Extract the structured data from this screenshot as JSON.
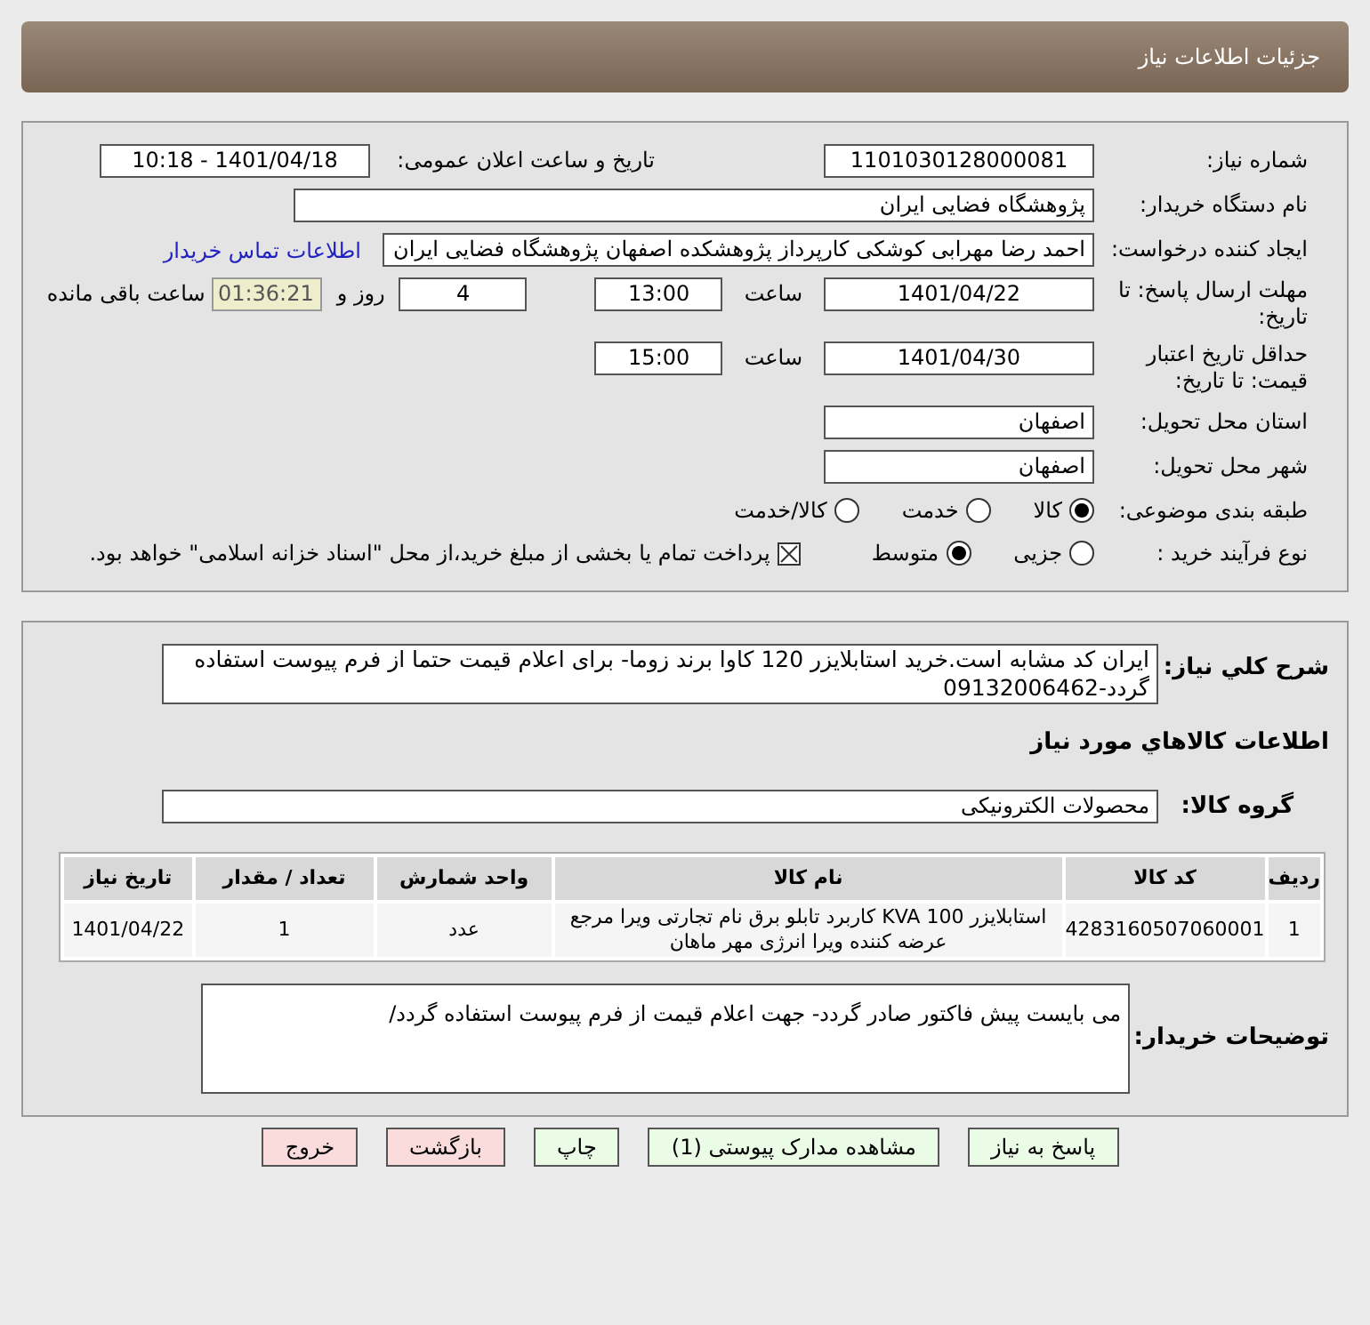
{
  "header": {
    "title": "جزئیات اطلاعات نیاز"
  },
  "need": {
    "need_number": {
      "label": "شماره نیاز:",
      "value": "1101030128000081"
    },
    "announce": {
      "label": "تاریخ و ساعت اعلان عمومی:",
      "value": "1401/04/18 - 10:18"
    },
    "buyer_org": {
      "label": "نام دستگاه خریدار:",
      "value": "پژوهشگاه فضایی ایران"
    },
    "requester": {
      "label": "ایجاد کننده درخواست:",
      "value": "احمد رضا مهرابی کوشکی کارپرداز پژوهشکده اصفهان پژوهشگاه فضایی ایران",
      "link": "اطلاعات تماس خریدار"
    },
    "response_deadline": {
      "label": "مهلت ارسال پاسخ: تا تاریخ:",
      "date": "1401/04/22",
      "time_label": "ساعت",
      "time": "13:00",
      "days": "4",
      "days_label": "روز و",
      "remaining": "01:36:21",
      "remaining_label": "ساعت باقی مانده"
    },
    "price_validity": {
      "label": "حداقل تاریخ اعتبار قیمت: تا تاریخ:",
      "date": "1401/04/30",
      "time_label": "ساعت",
      "time": "15:00"
    },
    "province": {
      "label": "استان محل تحویل:",
      "value": "اصفهان"
    },
    "city": {
      "label": "شهر محل تحویل:",
      "value": "اصفهان"
    },
    "category": {
      "label": "طبقه بندی موضوعی:",
      "options": [
        {
          "label": "کالا",
          "selected": true
        },
        {
          "label": "خدمت",
          "selected": false
        },
        {
          "label": "کالا/خدمت",
          "selected": false
        }
      ]
    },
    "process": {
      "label": "نوع فرآیند خرید :",
      "options": [
        {
          "label": "جزیی",
          "selected": false
        },
        {
          "label": "متوسط",
          "selected": true
        }
      ],
      "payment": {
        "label": "پرداخت تمام یا بخشی از مبلغ خرید،از محل \"اسناد خزانه اسلامی\" خواهد بود.",
        "checked": true
      }
    }
  },
  "goods": {
    "description": {
      "label": "شرح کلي نياز:",
      "value": "ایران کد مشابه است.خرید استابلایزر 120 کاوا برند زوما- برای اعلام قیمت حتما از فرم پیوست استفاده گردد-09132006462"
    },
    "section_title": "اطلاعات کالاهاي مورد نياز",
    "group": {
      "label": "گروه کالا:",
      "value": "محصولات الکترونیکی"
    },
    "table": {
      "columns": [
        "ردیف",
        "کد کالا",
        "نام کالا",
        "واحد شمارش",
        "تعداد / مقدار",
        "تاریخ نیاز"
      ],
      "rows": [
        [
          "1",
          "4283160507060001",
          "استابلایزر KVA 100 کاربرد تابلو برق نام تجارتی ویرا مرجع عرضه کننده ویرا انرژی مهر ماهان",
          "عدد",
          "1",
          "1401/04/22"
        ]
      ]
    },
    "buyer_notes": {
      "label": "توضیحات خریدار:",
      "value": "می بایست پیش فاکتور صادر گردد- جهت اعلام قیمت از فرم پیوست استفاده گردد/"
    }
  },
  "buttons": [
    {
      "label": "پاسخ به نیاز",
      "kind": "green"
    },
    {
      "label": "مشاهده مدارک پیوستی (1)",
      "kind": "green"
    },
    {
      "label": "چاپ",
      "kind": "green"
    },
    {
      "label": "بازگشت",
      "kind": "red"
    },
    {
      "label": "خروج",
      "kind": "red"
    }
  ]
}
